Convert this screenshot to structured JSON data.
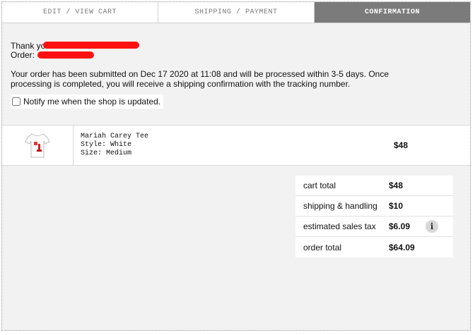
{
  "tabs": [
    {
      "label": "EDIT / VIEW CART"
    },
    {
      "label": "SHIPPING / PAYMENT"
    },
    {
      "label": "CONFIRMATION"
    }
  ],
  "confirmation": {
    "thank_you": "Thank you",
    "order_label": "Order:",
    "message": "Your order has been submitted on Dec 17 2020 at 11:08 and will be processed within 3-5 days. Once processing is completed, you will receive a shipping confirmation with the tracking number.",
    "notify_label": "Notify me when the shop is updated."
  },
  "item": {
    "name": "Mariah Carey Tee",
    "style": "Style: White",
    "size": "Size: Medium",
    "price": "$48"
  },
  "totals": {
    "cart_total_label": "cart total",
    "cart_total_value": "$48",
    "shipping_label": "shipping & handling",
    "shipping_value": "$10",
    "tax_label": "estimated sales tax",
    "tax_value": "$6.09",
    "order_total_label": "order total",
    "order_total_value": "$64.09",
    "info_glyph": "i"
  },
  "colors": {
    "active_tab": "#7b7b7b",
    "background": "#f2f2f2",
    "redaction": "#ff1111"
  }
}
